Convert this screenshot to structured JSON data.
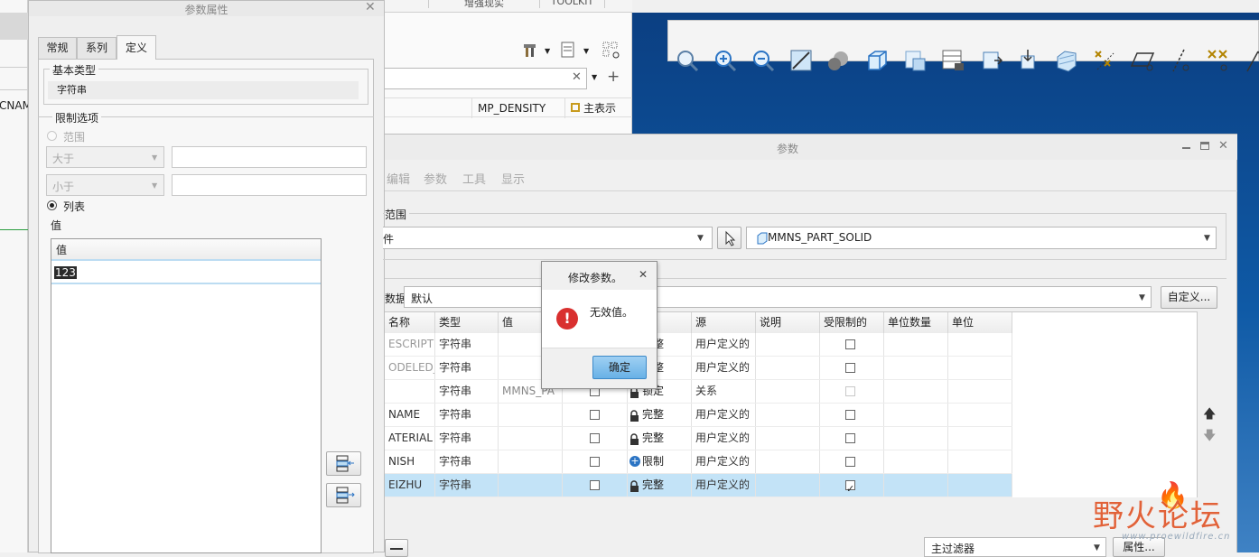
{
  "top_strip": {
    "tab1": "增强现实",
    "tab2": "TOOLKIT"
  },
  "bg_panel": {
    "left_col_text": "CNAM",
    "column_header_1": "MP_DENSITY",
    "column_header_2": "主表示"
  },
  "props_dialog": {
    "title": "参数属性",
    "tabs": [
      {
        "label": "常规"
      },
      {
        "label": "系列"
      },
      {
        "label": "定义"
      }
    ],
    "basic_type_label": "基本类型",
    "basic_type_value": "字符串",
    "restriction_label": "限制选项",
    "range_label": "范围",
    "greater_label": "大于",
    "less_label": "小于",
    "list_label": "列表",
    "value_label": "值",
    "list_header": "值",
    "list_values": [
      "123"
    ]
  },
  "params_dialog": {
    "title": "参数",
    "menu": [
      "编辑",
      "参数",
      "工具",
      "显示"
    ],
    "scope_label": "范围",
    "scope_type_value": "件",
    "scope_object": "MMNS_PART_SOLID",
    "filter_label": "数据",
    "filter_value": "默认",
    "customize_button": "自定义...",
    "columns": [
      "名称",
      "类型",
      "值",
      "",
      "",
      "源",
      "说明",
      "受限制的",
      "单位数量",
      "单位"
    ],
    "rows": [
      {
        "name": "ESCRIPTI",
        "type": "字符串",
        "value": "",
        "access": "完整",
        "source": "用户定义的",
        "restricted": false
      },
      {
        "name": "ODELED_",
        "type": "字符串",
        "value": "",
        "access": "完整",
        "source": "用户定义的",
        "restricted": false
      },
      {
        "name": "",
        "type": "字符串",
        "value": "MMNS_PA",
        "access": "锁定",
        "source": "关系",
        "restricted": false
      },
      {
        "name": "NAME",
        "type": "字符串",
        "value": "",
        "access": "完整",
        "source": "用户定义的",
        "restricted": false
      },
      {
        "name": "ATERIAL",
        "type": "字符串",
        "value": "",
        "access": "完整",
        "source": "用户定义的",
        "restricted": false
      },
      {
        "name": "NISH",
        "type": "字符串",
        "value": "",
        "access": "限制",
        "source": "用户定义的",
        "restricted": false
      },
      {
        "name": "EIZHU",
        "type": "字符串",
        "value": "",
        "access": "完整",
        "source": "用户定义的",
        "restricted": true
      }
    ],
    "bottom_filter": "主过滤器",
    "bottom_props": "属性..."
  },
  "error_dialog": {
    "title": "修改参数。",
    "message": "无效值。",
    "ok_button": "确定"
  },
  "watermark": {
    "text": "野火论坛",
    "url": "www.proewildfire.cn"
  },
  "colors": {
    "accent_blue": "#0a4a8c",
    "selection": "#c3e3f7",
    "error_red": "#d9302f",
    "watermark": "#e0562a"
  }
}
